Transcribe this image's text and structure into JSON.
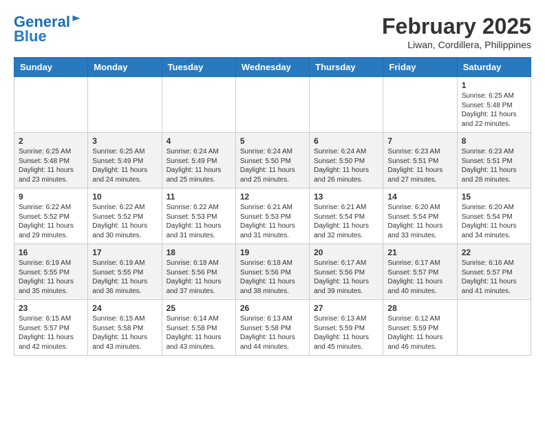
{
  "header": {
    "logo_line1": "General",
    "logo_line2": "Blue",
    "month_year": "February 2025",
    "location": "Liwan, Cordillera, Philippines"
  },
  "weekdays": [
    "Sunday",
    "Monday",
    "Tuesday",
    "Wednesday",
    "Thursday",
    "Friday",
    "Saturday"
  ],
  "weeks": [
    [
      {
        "day": "",
        "info": ""
      },
      {
        "day": "",
        "info": ""
      },
      {
        "day": "",
        "info": ""
      },
      {
        "day": "",
        "info": ""
      },
      {
        "day": "",
        "info": ""
      },
      {
        "day": "",
        "info": ""
      },
      {
        "day": "1",
        "info": "Sunrise: 6:25 AM\nSunset: 5:48 PM\nDaylight: 11 hours and 22 minutes."
      }
    ],
    [
      {
        "day": "2",
        "info": "Sunrise: 6:25 AM\nSunset: 5:48 PM\nDaylight: 11 hours and 23 minutes."
      },
      {
        "day": "3",
        "info": "Sunrise: 6:25 AM\nSunset: 5:49 PM\nDaylight: 11 hours and 24 minutes."
      },
      {
        "day": "4",
        "info": "Sunrise: 6:24 AM\nSunset: 5:49 PM\nDaylight: 11 hours and 25 minutes."
      },
      {
        "day": "5",
        "info": "Sunrise: 6:24 AM\nSunset: 5:50 PM\nDaylight: 11 hours and 25 minutes."
      },
      {
        "day": "6",
        "info": "Sunrise: 6:24 AM\nSunset: 5:50 PM\nDaylight: 11 hours and 26 minutes."
      },
      {
        "day": "7",
        "info": "Sunrise: 6:23 AM\nSunset: 5:51 PM\nDaylight: 11 hours and 27 minutes."
      },
      {
        "day": "8",
        "info": "Sunrise: 6:23 AM\nSunset: 5:51 PM\nDaylight: 11 hours and 28 minutes."
      }
    ],
    [
      {
        "day": "9",
        "info": "Sunrise: 6:22 AM\nSunset: 5:52 PM\nDaylight: 11 hours and 29 minutes."
      },
      {
        "day": "10",
        "info": "Sunrise: 6:22 AM\nSunset: 5:52 PM\nDaylight: 11 hours and 30 minutes."
      },
      {
        "day": "11",
        "info": "Sunrise: 6:22 AM\nSunset: 5:53 PM\nDaylight: 11 hours and 31 minutes."
      },
      {
        "day": "12",
        "info": "Sunrise: 6:21 AM\nSunset: 5:53 PM\nDaylight: 11 hours and 31 minutes."
      },
      {
        "day": "13",
        "info": "Sunrise: 6:21 AM\nSunset: 5:54 PM\nDaylight: 11 hours and 32 minutes."
      },
      {
        "day": "14",
        "info": "Sunrise: 6:20 AM\nSunset: 5:54 PM\nDaylight: 11 hours and 33 minutes."
      },
      {
        "day": "15",
        "info": "Sunrise: 6:20 AM\nSunset: 5:54 PM\nDaylight: 11 hours and 34 minutes."
      }
    ],
    [
      {
        "day": "16",
        "info": "Sunrise: 6:19 AM\nSunset: 5:55 PM\nDaylight: 11 hours and 35 minutes."
      },
      {
        "day": "17",
        "info": "Sunrise: 6:19 AM\nSunset: 5:55 PM\nDaylight: 11 hours and 36 minutes."
      },
      {
        "day": "18",
        "info": "Sunrise: 6:18 AM\nSunset: 5:56 PM\nDaylight: 11 hours and 37 minutes."
      },
      {
        "day": "19",
        "info": "Sunrise: 6:18 AM\nSunset: 5:56 PM\nDaylight: 11 hours and 38 minutes."
      },
      {
        "day": "20",
        "info": "Sunrise: 6:17 AM\nSunset: 5:56 PM\nDaylight: 11 hours and 39 minutes."
      },
      {
        "day": "21",
        "info": "Sunrise: 6:17 AM\nSunset: 5:57 PM\nDaylight: 11 hours and 40 minutes."
      },
      {
        "day": "22",
        "info": "Sunrise: 6:16 AM\nSunset: 5:57 PM\nDaylight: 11 hours and 41 minutes."
      }
    ],
    [
      {
        "day": "23",
        "info": "Sunrise: 6:15 AM\nSunset: 5:57 PM\nDaylight: 11 hours and 42 minutes."
      },
      {
        "day": "24",
        "info": "Sunrise: 6:15 AM\nSunset: 5:58 PM\nDaylight: 11 hours and 43 minutes."
      },
      {
        "day": "25",
        "info": "Sunrise: 6:14 AM\nSunset: 5:58 PM\nDaylight: 11 hours and 43 minutes."
      },
      {
        "day": "26",
        "info": "Sunrise: 6:13 AM\nSunset: 5:58 PM\nDaylight: 11 hours and 44 minutes."
      },
      {
        "day": "27",
        "info": "Sunrise: 6:13 AM\nSunset: 5:59 PM\nDaylight: 11 hours and 45 minutes."
      },
      {
        "day": "28",
        "info": "Sunrise: 6:12 AM\nSunset: 5:59 PM\nDaylight: 11 hours and 46 minutes."
      },
      {
        "day": "",
        "info": ""
      }
    ]
  ]
}
